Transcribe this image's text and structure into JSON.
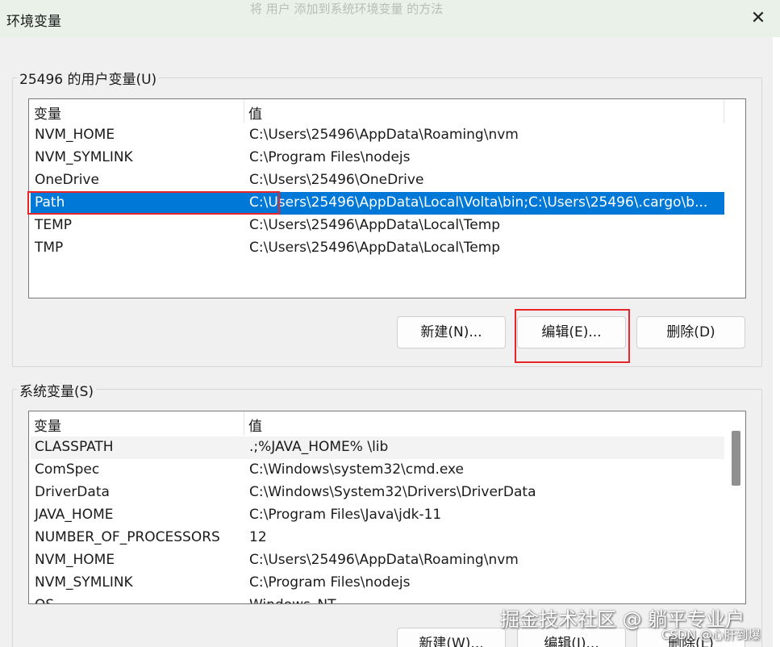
{
  "window": {
    "title": "环境变量",
    "background_text": "将 用户 添加到系统环境变量 的方法",
    "close_symbol": "✕"
  },
  "user_vars": {
    "legend": "25496 的用户变量(U)",
    "header": {
      "name": "变量",
      "value": "值"
    },
    "rows": [
      {
        "name": "NVM_HOME",
        "value": "C:\\Users\\25496\\AppData\\Roaming\\nvm"
      },
      {
        "name": "NVM_SYMLINK",
        "value": "C:\\Program Files\\nodejs"
      },
      {
        "name": "OneDrive",
        "value": "C:\\Users\\25496\\OneDrive"
      },
      {
        "name": "Path",
        "value": "C:\\Users\\25496\\AppData\\Local\\Volta\\bin;C:\\Users\\25496\\.cargo\\b..."
      },
      {
        "name": "TEMP",
        "value": "C:\\Users\\25496\\AppData\\Local\\Temp"
      },
      {
        "name": "TMP",
        "value": "C:\\Users\\25496\\AppData\\Local\\Temp"
      }
    ],
    "buttons": {
      "new": "新建(N)...",
      "edit": "编辑(E)...",
      "delete": "删除(D)"
    }
  },
  "system_vars": {
    "legend": "系统变量(S)",
    "header": {
      "name": "变量",
      "value": "值"
    },
    "rows": [
      {
        "name": "CLASSPATH",
        "value": ".;%JAVA_HOME% \\lib"
      },
      {
        "name": "ComSpec",
        "value": "C:\\Windows\\system32\\cmd.exe"
      },
      {
        "name": "DriverData",
        "value": "C:\\Windows\\System32\\Drivers\\DriverData"
      },
      {
        "name": "JAVA_HOME",
        "value": "C:\\Program Files\\Java\\jdk-11"
      },
      {
        "name": "NUMBER_OF_PROCESSORS",
        "value": "12"
      },
      {
        "name": "NVM_HOME",
        "value": "C:\\Users\\25496\\AppData\\Roaming\\nvm"
      },
      {
        "name": "NVM_SYMLINK",
        "value": "C:\\Program Files\\nodejs"
      },
      {
        "name": "OS",
        "value": "Windows_NT"
      }
    ],
    "buttons": {
      "new": "新建(W)...",
      "edit": "编辑(I)...",
      "delete": "删除(L)"
    }
  },
  "watermark": {
    "main": "掘金技术社区 @ 躺平专业户",
    "sub": "CSDN @心肝到爆"
  },
  "colors": {
    "selection": "#0078d7",
    "highlight_box": "#e8262a",
    "titlebar": "#e9f1e9",
    "dialog_bg": "#f0f0f0"
  }
}
